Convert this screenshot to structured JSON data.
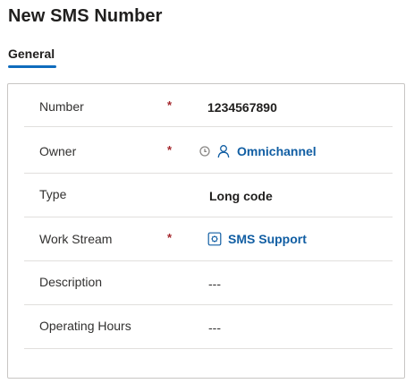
{
  "page": {
    "title": "New SMS Number"
  },
  "tabs": [
    {
      "label": "General",
      "selected": true
    }
  ],
  "form": {
    "fields": [
      {
        "label": "Number",
        "required": true,
        "value": "1234567890",
        "type": "text"
      },
      {
        "label": "Owner",
        "required": true,
        "value": "Omnichannel",
        "type": "lookup",
        "icon": "person-icon",
        "status_icon": "clock-icon"
      },
      {
        "label": "Type",
        "required": false,
        "value": "Long code",
        "type": "text"
      },
      {
        "label": "Work Stream",
        "required": true,
        "value": "SMS Support",
        "type": "lookup",
        "icon": "workstream-icon"
      },
      {
        "label": "Description",
        "required": false,
        "value": "---",
        "type": "text"
      },
      {
        "label": "Operating Hours",
        "required": false,
        "value": "---",
        "type": "text"
      }
    ],
    "required_marker": "*"
  },
  "colors": {
    "accent": "#0f6cbd",
    "link": "#115ea3",
    "required": "#a4262c",
    "border": "#c8c6c4",
    "divider": "#e1dfdd"
  }
}
